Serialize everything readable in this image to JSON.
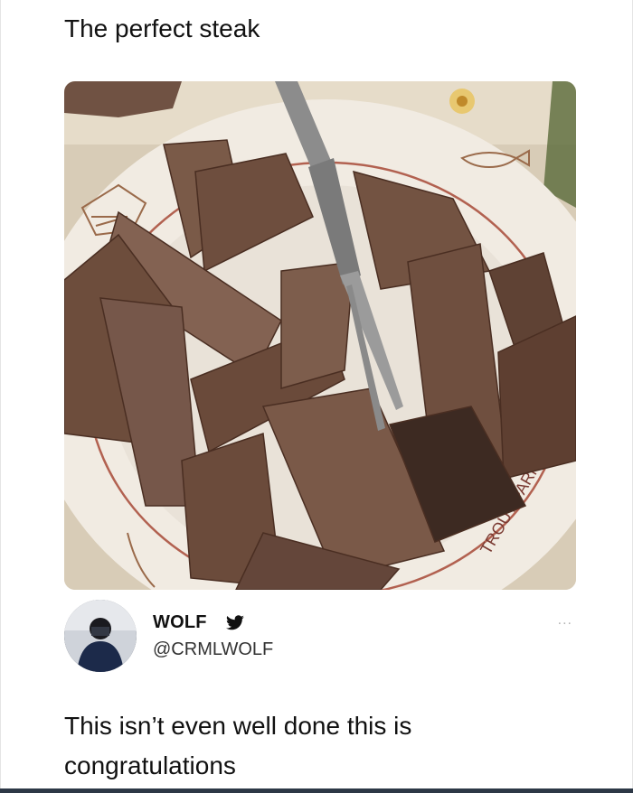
{
  "post": {
    "title": "The perfect steak"
  },
  "photo": {
    "plate_rim_text": "TROUT FARM"
  },
  "tweet": {
    "display_name": "WOLF",
    "handle": "@CRMLWOLF",
    "more_menu": "...",
    "text": "This isn’t even well done this is congratulations"
  },
  "icons": {
    "verified": "twitter-bird-icon",
    "more": "more-options-icon"
  },
  "colors": {
    "background": "#ffffff",
    "text": "#111111",
    "bottom_bar": "#2d3846"
  }
}
